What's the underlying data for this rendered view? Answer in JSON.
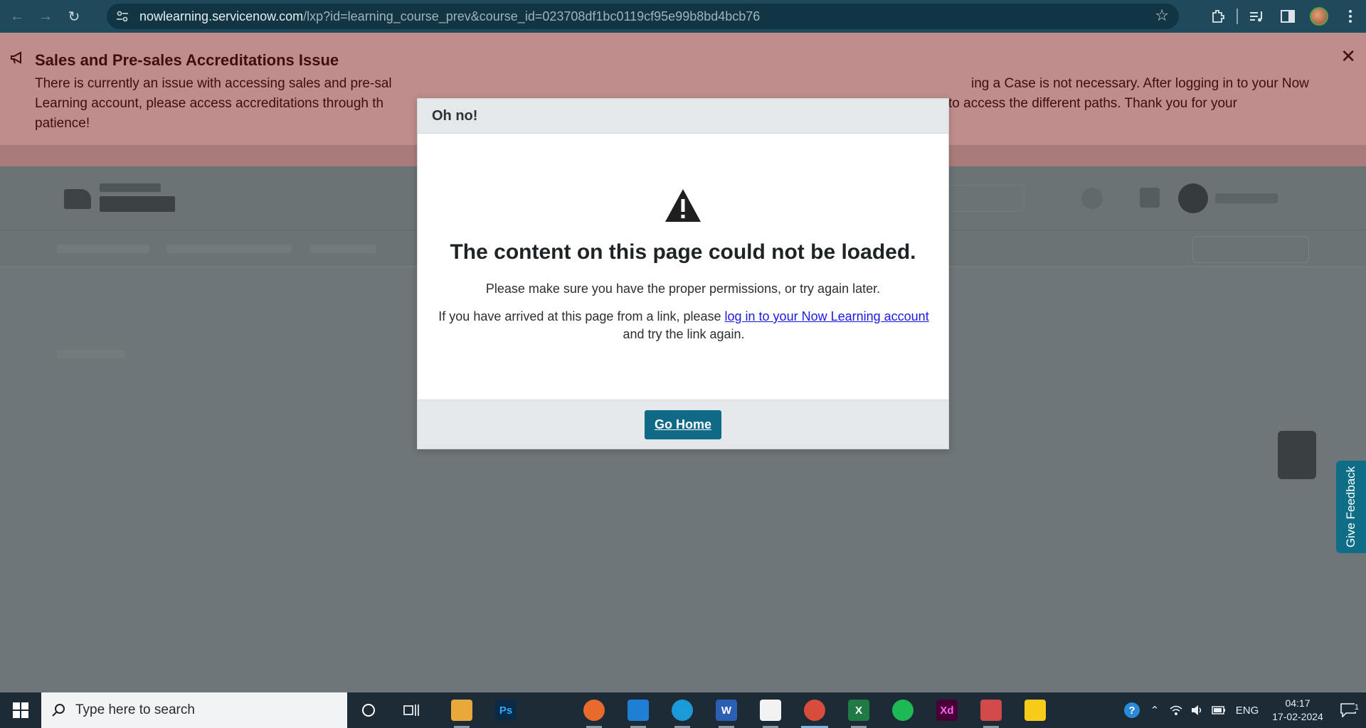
{
  "browser": {
    "url_host": "nowlearning.servicenow.com",
    "url_path": "/lxp?id=learning_course_prev&course_id=023708df1bc0119cf95e99b8bd4bcb76"
  },
  "banner": {
    "title": "Sales and Pre-sales Accreditations Issue",
    "text_left_1": "There is currently an issue with accessing sales and pre-sal",
    "text_right_1": "ing a Case is not necessary. After logging in to your Now",
    "text_left_2": "Learning account, please access accreditations through th",
    "text_right_2": "to access the different paths. Thank you for your",
    "text_3": "patience!"
  },
  "modal": {
    "header": "Oh no!",
    "title": "The content on this page could not be loaded.",
    "line1": "Please make sure you have the proper permissions, or try again later.",
    "line2_prefix": "If you have arrived at this page from a link, please ",
    "line2_link": "log in to your Now Learning account",
    "line2_suffix": "and try the link again.",
    "button": "Go Home"
  },
  "feedback": {
    "label": "Give Feedback"
  },
  "taskbar": {
    "search_placeholder": "Type here to search",
    "apps": [
      {
        "name": "File Explorer",
        "color": "#e8a93a"
      },
      {
        "name": "Photoshop",
        "color": "#0b2a45",
        "text": "Ps"
      },
      {
        "name": "App",
        "color": "#1d2b36"
      },
      {
        "name": "Firefox",
        "color": "#e86a2c"
      },
      {
        "name": "VS Code",
        "color": "#1f7fd4"
      },
      {
        "name": "Edge",
        "color": "#1a9ad6"
      },
      {
        "name": "Word",
        "color": "#2b5fb4",
        "text": "W"
      },
      {
        "name": "App",
        "color": "#f2f2f2"
      },
      {
        "name": "Chrome",
        "color": "#d94b3b"
      },
      {
        "name": "Excel",
        "color": "#1f7a45",
        "text": "X"
      },
      {
        "name": "Spotify",
        "color": "#1db954"
      },
      {
        "name": "Adobe XD",
        "color": "#470137",
        "text": "Xd"
      },
      {
        "name": "Snipping Tool",
        "color": "#d04a4a"
      },
      {
        "name": "Sticky Notes",
        "color": "#f7cb1a"
      }
    ],
    "lang": "ENG",
    "time": "04:17",
    "date": "17-02-2024",
    "notif_count": "1"
  }
}
